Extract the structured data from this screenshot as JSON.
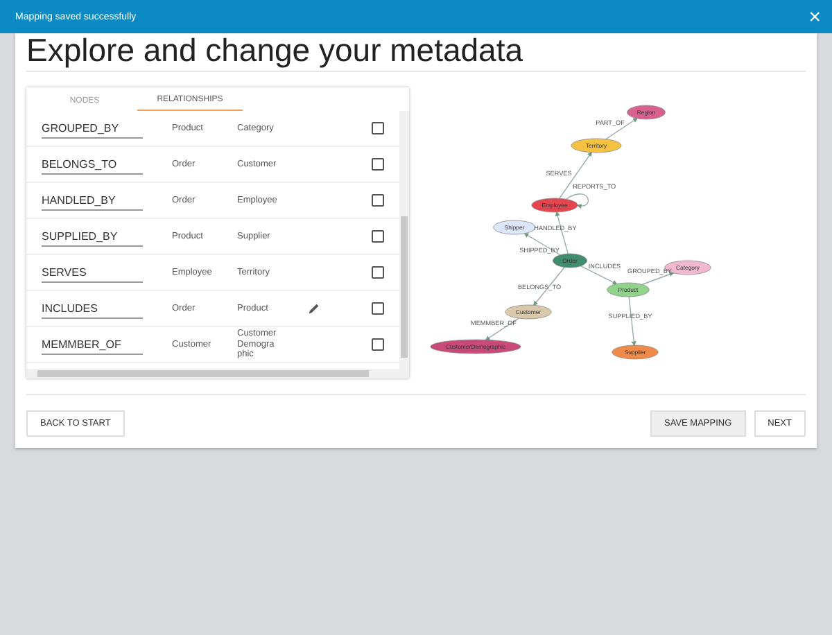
{
  "notification": {
    "message": "Mapping saved successfully",
    "close": "×"
  },
  "title": "Explore and change your metadata",
  "tabs": [
    {
      "label": "NODES",
      "selected": false
    },
    {
      "label": "RELATIONSHIPS",
      "selected": true
    }
  ],
  "relationships": [
    {
      "name": "GROUPED_BY",
      "from": "Product",
      "to": "Category",
      "checked": false,
      "edit_icon": false
    },
    {
      "name": "BELONGS_TO",
      "from": "Order",
      "to": "Customer",
      "checked": false,
      "edit_icon": false
    },
    {
      "name": "HANDLED_BY",
      "from": "Order",
      "to": "Employee",
      "checked": false,
      "edit_icon": false
    },
    {
      "name": "SUPPLIED_BY",
      "from": "Product",
      "to": "Supplier",
      "checked": false,
      "edit_icon": false
    },
    {
      "name": "SERVES",
      "from": "Employee",
      "to": "Territory",
      "checked": false,
      "edit_icon": false
    },
    {
      "name": "INCLUDES",
      "from": "Order",
      "to": "Product",
      "checked": false,
      "edit_icon": true
    },
    {
      "name": "MEMMBER_OF",
      "from": "Customer",
      "to": "CustomerDemographic",
      "checked": false,
      "edit_icon": false
    }
  ],
  "graph": {
    "nodes": [
      {
        "label": "Region",
        "color": "#d9618f"
      },
      {
        "label": "Territory",
        "color": "#f5c242"
      },
      {
        "label": "Employee",
        "color": "#e5454c"
      },
      {
        "label": "Shipper",
        "color": "#dbe6fb"
      },
      {
        "label": "Order",
        "color": "#3f8c6e"
      },
      {
        "label": "Customer",
        "color": "#d9c8aa"
      },
      {
        "label": "CustomerDemographic",
        "color": "#c94a78"
      },
      {
        "label": "Product",
        "color": "#8fd48a"
      },
      {
        "label": "Category",
        "color": "#f2b8d0"
      },
      {
        "label": "Supplier",
        "color": "#f08a4b"
      }
    ],
    "edges": [
      {
        "label": "PART_OF"
      },
      {
        "label": "SERVES"
      },
      {
        "label": "REPORTS_TO"
      },
      {
        "label": "HANDLED_BY"
      },
      {
        "label": "SHIPPED_BY"
      },
      {
        "label": "INCLUDES"
      },
      {
        "label": "BELONGS_TO"
      },
      {
        "label": "GROUPED_BY"
      },
      {
        "label": "MEMMBER_OF"
      },
      {
        "label": "SUPPLIED_BY"
      }
    ]
  },
  "buttons": [
    {
      "label": "BACK TO START",
      "kind": "secondary"
    },
    {
      "label": "SAVE MAPPING",
      "kind": "primary"
    },
    {
      "label": "NEXT",
      "kind": "secondary"
    }
  ]
}
